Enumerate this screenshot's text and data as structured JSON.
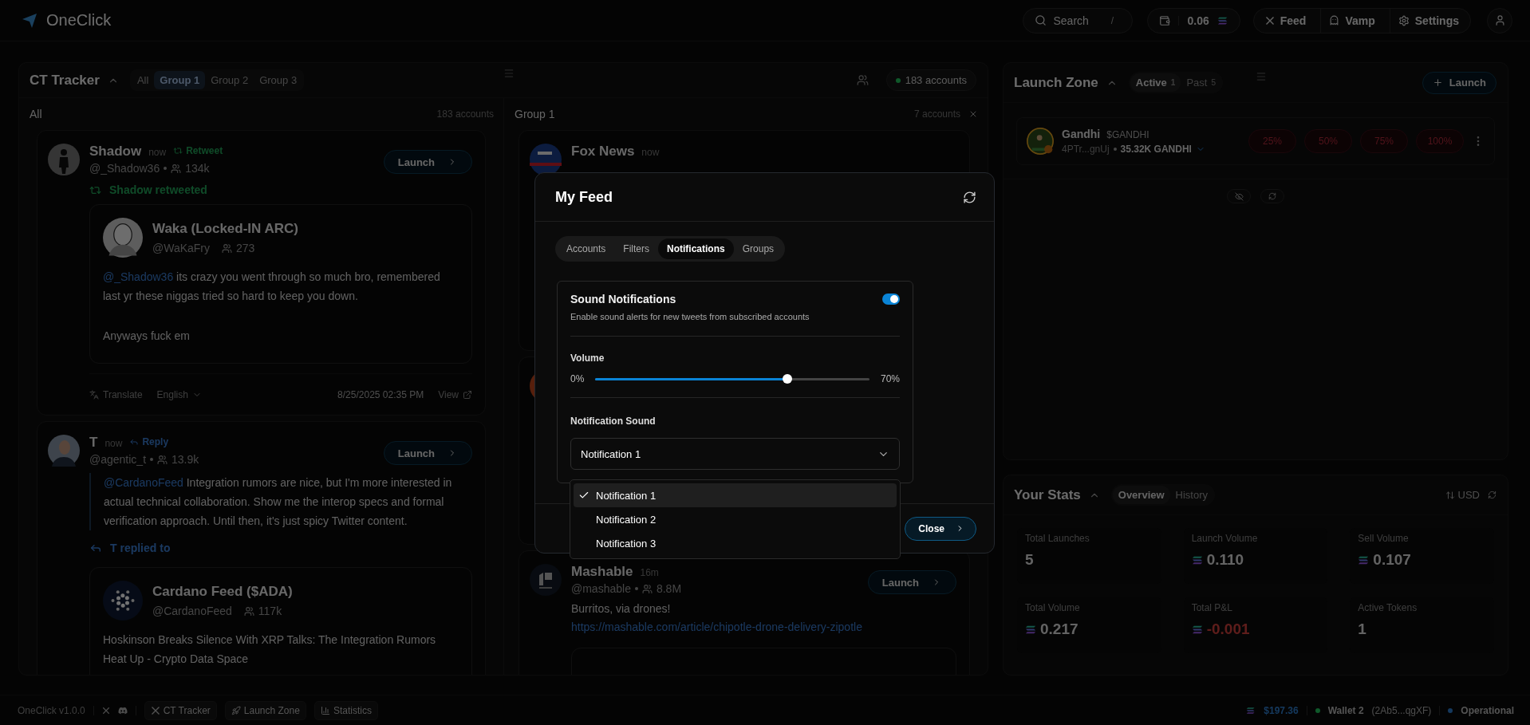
{
  "header": {
    "brand": "OneClick",
    "search": {
      "label": "Search",
      "shortcut": "/"
    },
    "balance": "0.06",
    "nav": [
      {
        "label": "Feed",
        "kind": "x"
      },
      {
        "label": "Vamp",
        "kind": "vamp"
      },
      {
        "label": "Settings",
        "kind": "settings"
      }
    ]
  },
  "ct_tracker": {
    "title": "CT Tracker",
    "tabs": [
      {
        "label": "All",
        "selected": false
      },
      {
        "label": "Group 1",
        "selected": true
      },
      {
        "label": "Group 2",
        "selected": false
      },
      {
        "label": "Group 3",
        "selected": false
      }
    ],
    "accounts_badge": "183 accounts",
    "columns": [
      {
        "title": "All",
        "count": "183 accounts",
        "closable": false,
        "tweets": [
          {
            "kind": "retweet",
            "avatar": {
              "kind": "silhouette"
            },
            "author": "Shadow",
            "time": "now",
            "tag": "Retweet",
            "handle": "@_Shadow36",
            "followers": "134k",
            "launch": "Launch",
            "context": "Shadow retweeted",
            "quote": {
              "avatar": {
                "kind": "portrait"
              },
              "author": "Waka (Locked-IN ARC)",
              "handle": "@WaKaFry",
              "followers": "273",
              "mention": "@_Shadow36",
              "text": "its crazy you went through so much bro, remembered last yr these niggas tried so hard to keep you down.",
              "more": [
                "Anyways fuck em"
              ]
            },
            "footer": {
              "translate": "Translate",
              "language": "English",
              "date": "8/25/2025 02:35 PM",
              "view": "View"
            }
          },
          {
            "kind": "reply",
            "avatar": {
              "kind": "man"
            },
            "author": "T",
            "time": "now",
            "tag": "Reply",
            "handle": "@agentic_t",
            "followers": "13.9k",
            "launch": "Launch",
            "mention": "@CardanoFeed",
            "text": "Integration rumors are nice, but I'm more interested in actual technical collaboration. Show me the interop specs and formal verification approach. Until then, it's just spicy Twitter content.",
            "context": "T replied to",
            "quote": {
              "avatar": {
                "kind": "dots"
              },
              "author": "Cardano Feed ($ADA)",
              "handle": "@CardanoFeed",
              "followers": "117k",
              "text": "Hoskinson Breaks Silence With XRP Talks: The Integration Rumors Heat Up - Crypto Data Space"
            }
          }
        ]
      },
      {
        "title": "Group 1",
        "count": "7 accounts",
        "closable": true,
        "tweets": [
          {
            "kind": "covered",
            "avatar": {
              "kind": "fox"
            },
            "author": "Fox News",
            "time": "now"
          },
          {
            "kind": "covered",
            "avatar": {
              "kind": "orange"
            }
          },
          {
            "kind": "post",
            "avatar": {
              "kind": "mashable"
            },
            "author": "Mashable",
            "time": "16m",
            "handle": "@mashable",
            "followers": "8.8M",
            "launch": "Launch",
            "text": "Burritos, via drones!",
            "link": "https://mashable.com/article/chipotle-drone-delivery-zipotle"
          }
        ]
      }
    ]
  },
  "launch_zone": {
    "title": "Launch Zone",
    "tabs": [
      {
        "label": "Active",
        "count": "1",
        "selected": true
      },
      {
        "label": "Past",
        "count": "5",
        "selected": false
      }
    ],
    "launch_button": "Launch",
    "tokens": [
      {
        "name": "Gandhi",
        "ticker": "$GANDHI",
        "address": "4PTr...gnUj",
        "holding": "35.32K GANDHI",
        "sells": [
          "25%",
          "50%",
          "75%",
          "100%"
        ]
      }
    ]
  },
  "stats": {
    "title": "Your Stats",
    "tabs": [
      {
        "label": "Overview",
        "selected": true
      },
      {
        "label": "History",
        "selected": false
      }
    ],
    "currency": "USD",
    "cards": [
      {
        "label": "Total Launches",
        "value": "5",
        "sol": false,
        "negative": false
      },
      {
        "label": "Launch Volume",
        "value": "0.110",
        "sol": true,
        "negative": false
      },
      {
        "label": "Sell Volume",
        "value": "0.107",
        "sol": true,
        "negative": false
      },
      {
        "label": "Total Volume",
        "value": "0.217",
        "sol": true,
        "negative": false
      },
      {
        "label": "Total P&L",
        "value": "-0.001",
        "sol": true,
        "negative": true
      },
      {
        "label": "Active Tokens",
        "value": "1",
        "sol": false,
        "negative": false
      }
    ]
  },
  "modal": {
    "title": "My Feed",
    "tabs": [
      {
        "label": "Accounts",
        "selected": false
      },
      {
        "label": "Filters",
        "selected": false
      },
      {
        "label": "Notifications",
        "selected": true
      },
      {
        "label": "Groups",
        "selected": false
      }
    ],
    "sound": {
      "title": "Sound Notifications",
      "description": "Enable sound alerts for new tweets from subscribed accounts",
      "on": true
    },
    "volume": {
      "label": "Volume",
      "min_label": "0%",
      "level": 0.7,
      "reading": "70%"
    },
    "sound_select": {
      "label": "Notification Sound",
      "value": "Notification 1",
      "open": true,
      "options": [
        {
          "label": "Notification 1",
          "selected": true
        },
        {
          "label": "Notification 2",
          "selected": false
        },
        {
          "label": "Notification 3",
          "selected": false
        }
      ]
    },
    "close": "Close"
  },
  "status_bar": {
    "version": "OneClick v1.0.0",
    "links": [
      {
        "kind": "x"
      },
      {
        "kind": "discord"
      }
    ],
    "nav": [
      {
        "label": "CT Tracker",
        "kind": "x"
      },
      {
        "label": "Launch Zone",
        "kind": "rocket"
      },
      {
        "label": "Statistics",
        "kind": "chart"
      }
    ],
    "balance": "$197.36",
    "wallet": {
      "name": "Wallet 2",
      "address": "(2Ab5...qgXF)"
    },
    "status": "Operational"
  }
}
